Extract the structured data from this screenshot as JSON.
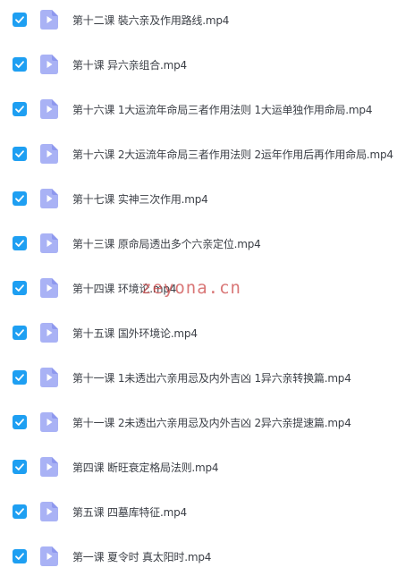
{
  "files": [
    {
      "name": "第十二课 裝六亲及作用路线.mp4",
      "checked": true
    },
    {
      "name": "第十课 异六亲组合.mp4",
      "checked": true
    },
    {
      "name": "第十六课 1大运流年命局三者作用法则 1大运单独作用命局.mp4",
      "checked": true
    },
    {
      "name": "第十六课 2大运流年命局三者作用法则 2运年作用后再作用命局.mp4",
      "checked": true
    },
    {
      "name": "第十七课 实神三次作用.mp4",
      "checked": true
    },
    {
      "name": "第十三课 原命局透出多个六亲定位.mp4",
      "checked": true
    },
    {
      "name": "第十四课 环境论.mp4",
      "checked": true
    },
    {
      "name": "第十五课 国外环境论.mp4",
      "checked": true
    },
    {
      "name": "第十一课 1未透出六亲用忌及内外吉凶 1异六亲转换篇.mp4",
      "checked": true
    },
    {
      "name": "第十一课 2未透出六亲用忌及内外吉凶 2异六亲提速篇.mp4",
      "checked": true
    },
    {
      "name": "第四课 断旺衰定格局法则.mp4",
      "checked": true
    },
    {
      "name": "第五课 四墓库特征.mp4",
      "checked": true
    },
    {
      "name": "第一课 夏令时 真太阳时.mp4",
      "checked": true
    }
  ],
  "watermark": "zeyona.cn",
  "colors": {
    "checkbox": "#1e9ff2",
    "video_icon": "#a9b2f5",
    "text": "#3b3f46"
  },
  "icons": {
    "checkbox": "checkmark-icon",
    "file": "video-file-icon"
  }
}
